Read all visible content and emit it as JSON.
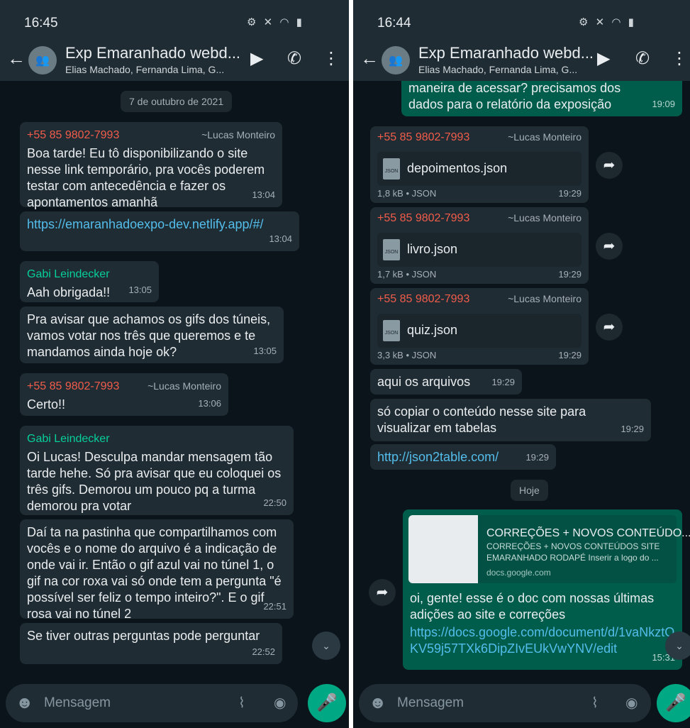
{
  "left": {
    "statusbar": {
      "time": "16:45",
      "icons": "▣ ▤"
    },
    "appbar": {
      "title": "Exp Emaranhado webd...",
      "subtitle": "Elias Machado, Fernanda Lima, G..."
    },
    "date_chip": "7 de outubro de 2021",
    "messages": [
      {
        "sender_num": "+55 85 9802-7993",
        "sender_name": "~Lucas Monteiro",
        "text": "Boa tarde! Eu tô disponibilizando o site nesse link temporário, pra vocês poderem testar com antecedência e fazer os apontamentos amanhã",
        "time": "13:04"
      },
      {
        "text": "https://emaranhadoexpo-dev.netlify.app/#/",
        "time": "13:04"
      },
      {
        "sender": "Gabi Leindecker",
        "text": "Aah obrigada!!",
        "time": "13:05"
      },
      {
        "text": "Pra avisar que achamos os gifs dos túneis, vamos votar nos três que queremos e te mandamos ainda hoje ok?",
        "time": "13:05"
      },
      {
        "sender_num": "+55 85 9802-7993",
        "sender_name": "~Lucas Monteiro",
        "text": "Certo!!",
        "time": "13:06"
      },
      {
        "sender": "Gabi Leindecker",
        "text": "Oi Lucas! Desculpa mandar mensagem tão tarde hehe. Só pra avisar que eu coloquei os três gifs. Demorou um pouco pq a turma demorou pra votar",
        "time": "22:50"
      },
      {
        "text": "Daí ta na pastinha que compartilhamos com vocês e o nome do arquivo é a indicação de onde vai ir. Então o gif azul vai no túnel 1, o gif na cor roxa vai só onde tem a pergunta \"é possível ser feliz o tempo inteiro?\". E o gif rosa vai no túnel 2",
        "time": "22:51"
      },
      {
        "text": "Se tiver outras perguntas pode perguntar",
        "time": "22:52"
      }
    ],
    "composer_placeholder": "Mensagem"
  },
  "right": {
    "statusbar": {
      "time": "16:44",
      "icons": "▣"
    },
    "appbar": {
      "title": "Exp Emaranhado webd...",
      "subtitle": "Elias Machado, Fernanda Lima, G..."
    },
    "top_message": {
      "text": "maneira de acessar? precisamos dos dados para o relatório da exposição",
      "time": "19:09"
    },
    "docs": [
      {
        "sender_num": "+55 85 9802-7993",
        "sender_name": "~Lucas Monteiro",
        "filename": "depoimentos.json",
        "meta": "1,8 kB • JSON",
        "time": "19:29"
      },
      {
        "sender_num": "+55 85 9802-7993",
        "sender_name": "~Lucas Monteiro",
        "filename": "livro.json",
        "meta": "1,7 kB • JSON",
        "time": "19:29"
      },
      {
        "sender_num": "+55 85 9802-7993",
        "sender_name": "~Lucas Monteiro",
        "filename": "quiz.json",
        "meta": "3,3 kB • JSON",
        "time": "19:29"
      }
    ],
    "messages": [
      {
        "text": "aqui os arquivos",
        "time": "19:29"
      },
      {
        "text": "só copiar o conteúdo nesse site para visualizar em tabelas",
        "time": "19:29"
      },
      {
        "text": "http://json2table.com/",
        "time": "19:29"
      }
    ],
    "date_chip": "Hoje",
    "link_message": {
      "preview_title": "CORREÇÕES + NOVOS CONTEÚDO...",
      "preview_desc": "CORREÇÕES + NOVOS CONTEÚDOS SITE EMARANHADO RODAPÉ Inserir a logo do ...",
      "preview_domain": "docs.google.com",
      "text": "oi, gente! esse é o doc com nossas últimas adições ao site e correções",
      "link": "https://docs.google.com/document/d/1vaNkztOKV59j57TXk6DipZIvEUkVwYNV/edit",
      "time": "15:31"
    },
    "composer_placeholder": "Mensagem"
  },
  "icons": {
    "back": "←",
    "video": "▶",
    "call": "✆",
    "menu": "⋮",
    "emoji": "☻",
    "clip": "⌇",
    "camera": "◉",
    "mic": "🎤",
    "forward": "➦",
    "scroll": "⌄",
    "group": "👥"
  }
}
